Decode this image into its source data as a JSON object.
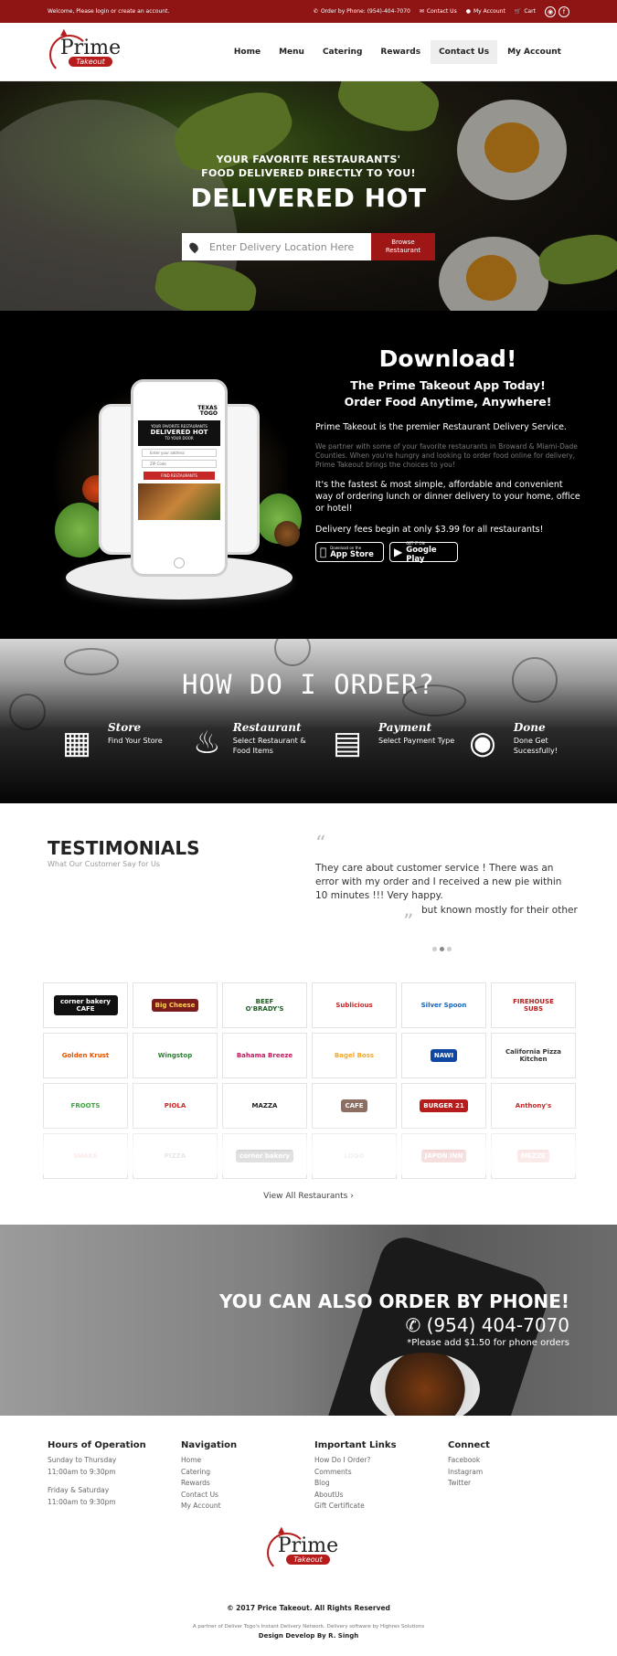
{
  "topbar": {
    "welcome": "Welcome, Please login or create an account.",
    "order_phone": "Order by Phone: (954)-404-7070",
    "contact": "Contact Us",
    "account": "My Account",
    "cart": "Cart",
    "colors": {
      "background": "#8f1414"
    }
  },
  "logo": {
    "name": "Prime",
    "tagline": "Takeout"
  },
  "nav": {
    "items": [
      {
        "label": "Home"
      },
      {
        "label": "Menu"
      },
      {
        "label": "Catering"
      },
      {
        "label": "Rewards"
      },
      {
        "label": "Contact Us",
        "active": true
      },
      {
        "label": "My Account"
      }
    ]
  },
  "hero": {
    "line1": "YOUR FAVORITE RESTAURANTS'",
    "line2": "FOOD DELIVERED DIRECTLY TO YOU!",
    "headline": "DELIVERED HOT",
    "search_placeholder": "Enter Delivery Location Here",
    "browse_label_1": "Browse",
    "browse_label_2": "Restaurant"
  },
  "app_phone": {
    "brand_1": "TEXAS",
    "brand_2": "TOGO",
    "s1": "YOUR FAVORITE RESTAURANTS",
    "s2": "DELIVERED HOT",
    "s3": "TO YOUR DOOR",
    "field1": "Enter your address",
    "field2": "ZIP Code",
    "find": "FIND RESTAURANTS"
  },
  "download": {
    "title": "Download!",
    "subtitle1": "The Prime Takeout App Today!",
    "subtitle2": "Order Food Anytime, Anywhere!",
    "p1": "Prime Takeout is the premier Restaurant Delivery Service.",
    "p2": "We partner with some of your favorite restaurants in Broward & Miami-Dade Counties. When you're hungry and looking to order food online for delivery, Prime Takeout brings the choices to you!",
    "p3": "It's the fastest & most simple, affordable and convenient way of ordering lunch or dinner delivery to your home, office or hotel!",
    "p4": "Delivery fees begin at only $3.99 for all restaurants!",
    "appstore_small": "Download on the",
    "appstore": "App Store",
    "google_small": "GET IT ON",
    "google": "Google Play"
  },
  "howto": {
    "title": "HOW DO I ORDER?",
    "steps": [
      {
        "title": "Store",
        "desc": "Find Your Store",
        "icon": "map-icon"
      },
      {
        "title": "Restaurant",
        "desc": "Select Restaurant & Food Items",
        "icon": "chef-hat-icon"
      },
      {
        "title": "Payment",
        "desc": "Select Payment Type",
        "icon": "credit-card-icon"
      },
      {
        "title": "Done",
        "desc": "Done Get Sucessfully!",
        "icon": "cloche-icon"
      }
    ]
  },
  "testimonials": {
    "title": "TESTIMONIALS",
    "subtitle": "What Our Customer Say for Us",
    "quote": "They care about customer service ! There was an error with my order and I received a new pie within 10 minutes !!! Very happy.",
    "quote_tail": "but known mostly for their other"
  },
  "restaurants": {
    "logos": [
      {
        "name": "corner bakery CAFE",
        "bg": "#111111",
        "fg": "#ffffff"
      },
      {
        "name": "Big Cheese",
        "bg": "#7a1c1c",
        "fg": "#ffd54f"
      },
      {
        "name": "BEEF O'BRADY'S",
        "bg": "#ffffff",
        "fg": "#1b5e20"
      },
      {
        "name": "Sublicious",
        "bg": "#ffffff",
        "fg": "#c62828"
      },
      {
        "name": "Silver Spoon",
        "bg": "#ffffff",
        "fg": "#1565c0"
      },
      {
        "name": "FIREHOUSE SUBS",
        "bg": "#ffffff",
        "fg": "#b71c1c"
      },
      {
        "name": "Golden Krust",
        "bg": "#ffffff",
        "fg": "#e65100"
      },
      {
        "name": "Wingstop",
        "bg": "#ffffff",
        "fg": "#2e7d32"
      },
      {
        "name": "Bahama Breeze",
        "bg": "#ffffff",
        "fg": "#c2185b"
      },
      {
        "name": "Bagel Boss",
        "bg": "#ffffff",
        "fg": "#f9a825"
      },
      {
        "name": "NAWI",
        "bg": "#0d47a1",
        "fg": "#ffffff"
      },
      {
        "name": "California Pizza Kitchen",
        "bg": "#ffffff",
        "fg": "#333333"
      },
      {
        "name": "FROOTS",
        "bg": "#ffffff",
        "fg": "#43a047"
      },
      {
        "name": "PIOLA",
        "bg": "#ffffff",
        "fg": "#c62828"
      },
      {
        "name": "MAZZA",
        "bg": "#ffffff",
        "fg": "#222222"
      },
      {
        "name": "CAFE",
        "bg": "#8d6e63",
        "fg": "#ffffff"
      },
      {
        "name": "BURGER 21",
        "bg": "#b71c1c",
        "fg": "#ffffff"
      },
      {
        "name": "Anthony's",
        "bg": "#ffffff",
        "fg": "#c62828"
      },
      {
        "name": "SHAKE",
        "bg": "#ffffff",
        "fg": "#e57373"
      },
      {
        "name": "PIZZA",
        "bg": "#ffffff",
        "fg": "#555555"
      },
      {
        "name": "corner bakery",
        "bg": "#333333",
        "fg": "#ffffff"
      },
      {
        "name": "LOGO",
        "bg": "#ffffff",
        "fg": "#999999"
      },
      {
        "name": "JAPON INN",
        "bg": "#c62828",
        "fg": "#ffffff"
      },
      {
        "name": "MEZZE",
        "bg": "#e57373",
        "fg": "#ffffff"
      }
    ],
    "view_all": "View All Restaurants ›"
  },
  "phone_order": {
    "title": "YOU CAN ALSO ORDER BY PHONE!",
    "phone": "(954) 404-7070",
    "note": "*Please add $1.50 for phone orders"
  },
  "footer": {
    "hours_title": "Hours of Operation",
    "hours": [
      "Sunday to Thursday",
      "11:00am to 9:30pm",
      "Friday & Saturday",
      "11:00am to 9:30pm"
    ],
    "nav_title": "Navigation",
    "nav": [
      "Home",
      "Catering",
      "Rewards",
      "Contact Us",
      "My Account"
    ],
    "links_title": "Important Links",
    "links": [
      "How Do I Order?",
      "Comments",
      "Blog",
      "AboutUs",
      "Gift Certificate"
    ],
    "connect_title": "Connect",
    "connect": [
      "Facebook",
      "Instagram",
      "Twitter"
    ],
    "copyright": "© 2017 Price Takeout. All Rights Reserved",
    "partner": "A partner of Deliver Togo's Instant Delivery Network. Delivery software by Highres Solutions",
    "design": "Design Develop By R. Singh"
  }
}
